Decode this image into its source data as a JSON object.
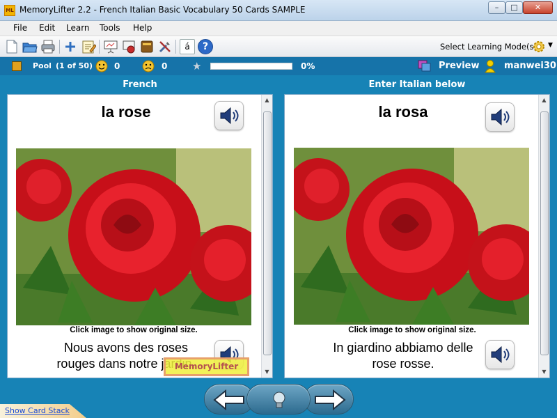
{
  "window": {
    "title": "MemoryLifter 2.2 - French Italian Basic Vocabulary 50 Cards SAMPLE",
    "app_icon_text": "ML",
    "controls": {
      "minimize": "–",
      "maximize": "□",
      "close": "✕"
    }
  },
  "menu": [
    "File",
    "Edit",
    "Learn",
    "Tools",
    "Help"
  ],
  "toolbar": {
    "icons": [
      "new-file-icon",
      "open-folder-icon",
      "print-icon",
      "add-icon",
      "edit-icon",
      "presentation-icon",
      "slideshow-icon",
      "book-icon",
      "settings-tools-icon",
      "character-map-icon",
      "help-icon"
    ],
    "character_map_label": "á",
    "help_label": "?",
    "mode_label": "Select Learning Mode(s)"
  },
  "status": {
    "pool_label": "Pool",
    "pool_count": "(1 of 50)",
    "happy_count": "0",
    "sad_count": "0",
    "progress_percent": "0%",
    "progress_value": 0,
    "preview_label": "Preview",
    "user_name": "manwei30"
  },
  "left_card": {
    "header": "French",
    "word": "la rose",
    "caption": "Click image to show original size.",
    "sentence_line1": "Nous avons des roses",
    "sentence_line2": "rouges dans notre jardin."
  },
  "right_card": {
    "header": "Enter Italian below",
    "word": "la rosa",
    "caption": "Click image to show original size.",
    "sentence_line1": "In giardino abbiamo delle",
    "sentence_line2": "rose rosse."
  },
  "watermark": "MemoryLifter",
  "footer": {
    "show_card_stack": "Show Card Stack"
  },
  "colors": {
    "statusbar": "#1673a9",
    "main_bg": "#1783b6",
    "progress_fill": "#4ab04a"
  }
}
